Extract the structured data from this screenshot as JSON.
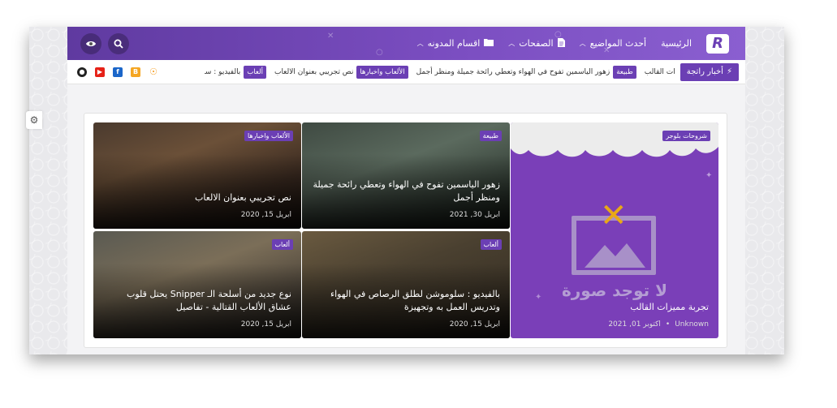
{
  "header": {
    "logo_letter": "R",
    "nav": [
      {
        "label": "الرئيسية",
        "has_dropdown": false,
        "icon": ""
      },
      {
        "label": "أحدث المواضيع",
        "has_dropdown": true,
        "icon": ""
      },
      {
        "label": "الصفحات",
        "has_dropdown": true,
        "icon": "page-icon"
      },
      {
        "label": "اقسام المدونه",
        "has_dropdown": true,
        "icon": "folder-icon"
      }
    ]
  },
  "ticker": {
    "label": "أخبار راتجة",
    "items": [
      {
        "category": "",
        "text": "ات القالب"
      },
      {
        "category": "طبيعة",
        "text": "زهور الياسمين تفوح في الهواء وتعطي رائحة جميلة ومنظر أجمل"
      },
      {
        "category": "الألعاب واخبارها",
        "text": "نص تجريبي بعنوان الالعاب"
      },
      {
        "category": "ألعاب",
        "text": "بالفيديو : سلومو"
      }
    ]
  },
  "posts": [
    {
      "badge": "شروحات بلوجر",
      "title": "تجربة مميزات القالب",
      "author": "Unknown",
      "date": "اكتوبر 01, 2021"
    },
    {
      "badge": "طبيعة",
      "title": "زهور الياسمين تفوح في الهواء وتعطي رائحة جميلة ومنظر أجمل",
      "date": "ابريل 30, 2021"
    },
    {
      "badge": "الألعاب واخبارها",
      "title": "نص تجريبي بعنوان الالعاب",
      "date": "ابريل 15, 2020"
    },
    {
      "badge": "ألعاب",
      "title": "بالفيديو : سلوموشن لطلق الرصاص في الهواء وتدريس العمل به وتجهيزة",
      "date": "ابريل 15, 2020"
    },
    {
      "badge": "ألعاب",
      "title": "نوع جديد من أسلحة الـ Snipper يحتل قلوب عشاق الألعاب القتالية - تفاصيل",
      "date": "ابريل 15, 2020"
    }
  ],
  "placeholder": {
    "text": "لا توجد صورة"
  },
  "colors": {
    "accent": "#6b3fb4",
    "header_start": "#5f3aa0",
    "header_end": "#8a5fd0"
  }
}
